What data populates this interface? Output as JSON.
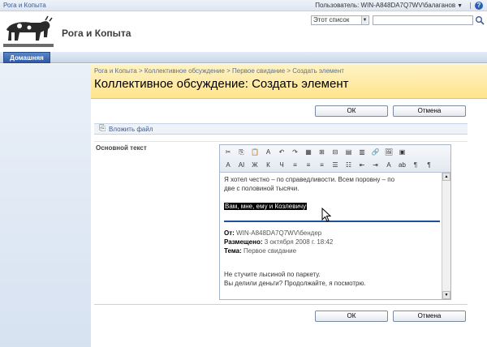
{
  "topbar": {
    "site_name": "Рога и Копыта",
    "user_label": "Пользователь: WIN-A848DA7Q7WV\\балаганов"
  },
  "header": {
    "site_title": "Рога и Копыта",
    "scope_value": "Этот список",
    "search_placeholder": ""
  },
  "nav": {
    "home_tab": "Домашняя"
  },
  "titlearea": {
    "breadcrumb": "Рога и Копыта > Коллективное обсуждение > Первое свидание > Создать элемент",
    "title": "Коллективное обсуждение: Создать элемент"
  },
  "buttons": {
    "ok": "ОК",
    "cancel": "Отмена"
  },
  "attach": {
    "label": "Вложить файл"
  },
  "form": {
    "field_label": "Основной текст"
  },
  "editor": {
    "line1": "Я хотел честно – по справедливости. Всем поровну – по",
    "line2": "две с половиной тысячи.",
    "selected": "Вам, мне, ему и Козлевичу",
    "from_label": "От:",
    "from_value": "WIN-A848DA7Q7WV\\бендер",
    "posted_label": "Размещено:",
    "posted_value": "3 октября 2008 г. 18:42",
    "topic_label": "Тема:",
    "topic_value": "Первое свидание",
    "reply1": "Не стучите лысиной по паркету.",
    "reply2": "Вы делили деньги? Продолжайте, я посмотрю."
  },
  "toolbar": {
    "row1": [
      "cut-icon",
      "copy-icon",
      "paste-icon",
      "paste-text-icon",
      "undo-icon",
      "redo-icon",
      "table-icon",
      "insert-column-icon",
      "insert-row-icon",
      "merge-icon",
      "split-icon",
      "link-icon",
      "image-icon",
      "table-props-icon"
    ],
    "row2": [
      "font-color-icon",
      "font-size-icon",
      "bold-icon",
      "italic-icon",
      "underline-icon",
      "align-left-icon",
      "align-center-icon",
      "align-right-icon",
      "numbering-icon",
      "bullets-icon",
      "outdent-icon",
      "indent-icon",
      "text-color-icon",
      "highlight-icon",
      "ltr-icon",
      "rtl-icon"
    ],
    "row1_glyphs": [
      "✂",
      "⎘",
      "📋",
      "A",
      "↶",
      "↷",
      "▦",
      "⊞",
      "⊟",
      "▤",
      "▥",
      "🔗",
      "🖼",
      "▣"
    ],
    "row2_glyphs": [
      "A",
      "AI",
      "Ж",
      "К",
      "Ч",
      "≡",
      "≡",
      "≡",
      "☰",
      "☷",
      "⇤",
      "⇥",
      "A",
      "ab",
      "¶",
      "¶"
    ]
  },
  "colors": {
    "accent": "#2e5aa6",
    "title_bg": "#ffe48d",
    "link": "#3a5a9a"
  }
}
